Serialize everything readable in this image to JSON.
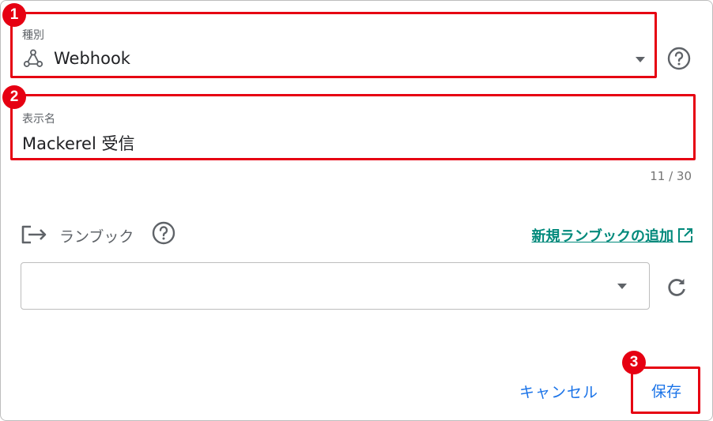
{
  "type_field": {
    "label": "種別",
    "value": "Webhook",
    "icon": "webhook-icon"
  },
  "name_field": {
    "label": "表示名",
    "value": "Mackerel 受信",
    "char_count": "11 / 30"
  },
  "runbook": {
    "label": "ランブック",
    "add_link": "新規ランブックの追加",
    "selected_value": ""
  },
  "footer": {
    "cancel_label": "キャンセル",
    "save_label": "保存"
  },
  "badges": {
    "one": "1",
    "two": "2",
    "three": "3"
  },
  "colors": {
    "highlight": "#e60012",
    "link": "#00897b",
    "primary": "#1a73e8"
  }
}
